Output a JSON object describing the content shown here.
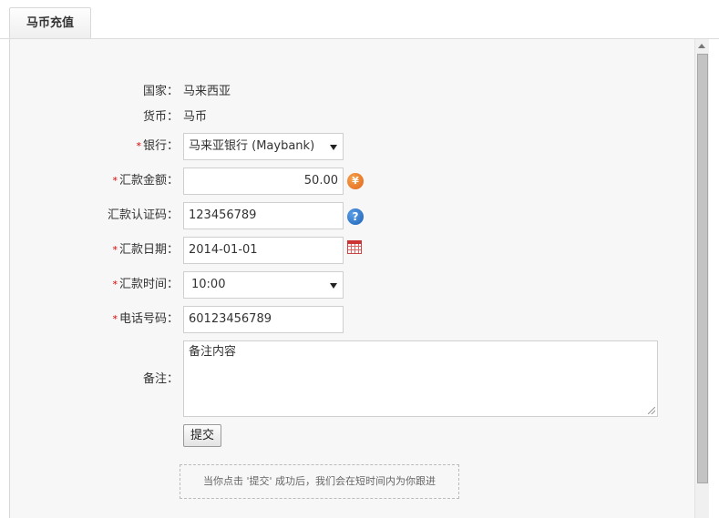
{
  "tab": {
    "title": "马币充值"
  },
  "form": {
    "country": {
      "label": "国家：",
      "value": "马来西亚"
    },
    "currency": {
      "label": "货币：",
      "value": "马币"
    },
    "bank": {
      "label": "银行：",
      "required": "*",
      "selected": "马来亚银行 (Maybank)"
    },
    "amount": {
      "label": "汇款金额：",
      "required": "*",
      "value": "50.00",
      "icon": "yen-coin-icon",
      "icon_glyph": "¥"
    },
    "code": {
      "label": "汇款认证码：",
      "value": "123456789",
      "icon": "help-icon",
      "icon_glyph": "?"
    },
    "date": {
      "label": "汇款日期：",
      "required": "*",
      "value": "2014-01-01",
      "icon": "calendar-icon"
    },
    "time": {
      "label": "汇款时间：",
      "required": "*",
      "selected": "10:00"
    },
    "phone": {
      "label": "电话号码：",
      "required": "*",
      "value": "60123456789"
    },
    "remark": {
      "label": "备注：",
      "value": "备注内容"
    },
    "submit_label": "提交",
    "notice": "当你点击 '提交' 成功后，我们会在短时间内为你跟进"
  },
  "colors": {
    "required": "#dd0000",
    "panel_bg": "#f7f7f7",
    "border": "#cfcfcf"
  }
}
